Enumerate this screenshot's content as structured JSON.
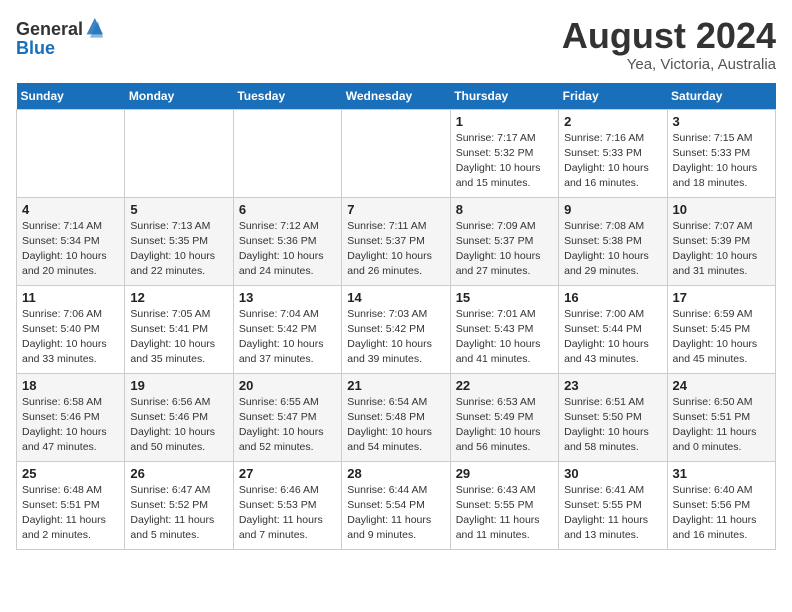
{
  "logo": {
    "general": "General",
    "blue": "Blue"
  },
  "header": {
    "month_year": "August 2024",
    "location": "Yea, Victoria, Australia"
  },
  "weekdays": [
    "Sunday",
    "Monday",
    "Tuesday",
    "Wednesday",
    "Thursday",
    "Friday",
    "Saturday"
  ],
  "weeks": [
    [
      {
        "day": "",
        "info": ""
      },
      {
        "day": "",
        "info": ""
      },
      {
        "day": "",
        "info": ""
      },
      {
        "day": "",
        "info": ""
      },
      {
        "day": "1",
        "info": "Sunrise: 7:17 AM\nSunset: 5:32 PM\nDaylight: 10 hours\nand 15 minutes."
      },
      {
        "day": "2",
        "info": "Sunrise: 7:16 AM\nSunset: 5:33 PM\nDaylight: 10 hours\nand 16 minutes."
      },
      {
        "day": "3",
        "info": "Sunrise: 7:15 AM\nSunset: 5:33 PM\nDaylight: 10 hours\nand 18 minutes."
      }
    ],
    [
      {
        "day": "4",
        "info": "Sunrise: 7:14 AM\nSunset: 5:34 PM\nDaylight: 10 hours\nand 20 minutes."
      },
      {
        "day": "5",
        "info": "Sunrise: 7:13 AM\nSunset: 5:35 PM\nDaylight: 10 hours\nand 22 minutes."
      },
      {
        "day": "6",
        "info": "Sunrise: 7:12 AM\nSunset: 5:36 PM\nDaylight: 10 hours\nand 24 minutes."
      },
      {
        "day": "7",
        "info": "Sunrise: 7:11 AM\nSunset: 5:37 PM\nDaylight: 10 hours\nand 26 minutes."
      },
      {
        "day": "8",
        "info": "Sunrise: 7:09 AM\nSunset: 5:37 PM\nDaylight: 10 hours\nand 27 minutes."
      },
      {
        "day": "9",
        "info": "Sunrise: 7:08 AM\nSunset: 5:38 PM\nDaylight: 10 hours\nand 29 minutes."
      },
      {
        "day": "10",
        "info": "Sunrise: 7:07 AM\nSunset: 5:39 PM\nDaylight: 10 hours\nand 31 minutes."
      }
    ],
    [
      {
        "day": "11",
        "info": "Sunrise: 7:06 AM\nSunset: 5:40 PM\nDaylight: 10 hours\nand 33 minutes."
      },
      {
        "day": "12",
        "info": "Sunrise: 7:05 AM\nSunset: 5:41 PM\nDaylight: 10 hours\nand 35 minutes."
      },
      {
        "day": "13",
        "info": "Sunrise: 7:04 AM\nSunset: 5:42 PM\nDaylight: 10 hours\nand 37 minutes."
      },
      {
        "day": "14",
        "info": "Sunrise: 7:03 AM\nSunset: 5:42 PM\nDaylight: 10 hours\nand 39 minutes."
      },
      {
        "day": "15",
        "info": "Sunrise: 7:01 AM\nSunset: 5:43 PM\nDaylight: 10 hours\nand 41 minutes."
      },
      {
        "day": "16",
        "info": "Sunrise: 7:00 AM\nSunset: 5:44 PM\nDaylight: 10 hours\nand 43 minutes."
      },
      {
        "day": "17",
        "info": "Sunrise: 6:59 AM\nSunset: 5:45 PM\nDaylight: 10 hours\nand 45 minutes."
      }
    ],
    [
      {
        "day": "18",
        "info": "Sunrise: 6:58 AM\nSunset: 5:46 PM\nDaylight: 10 hours\nand 47 minutes."
      },
      {
        "day": "19",
        "info": "Sunrise: 6:56 AM\nSunset: 5:46 PM\nDaylight: 10 hours\nand 50 minutes."
      },
      {
        "day": "20",
        "info": "Sunrise: 6:55 AM\nSunset: 5:47 PM\nDaylight: 10 hours\nand 52 minutes."
      },
      {
        "day": "21",
        "info": "Sunrise: 6:54 AM\nSunset: 5:48 PM\nDaylight: 10 hours\nand 54 minutes."
      },
      {
        "day": "22",
        "info": "Sunrise: 6:53 AM\nSunset: 5:49 PM\nDaylight: 10 hours\nand 56 minutes."
      },
      {
        "day": "23",
        "info": "Sunrise: 6:51 AM\nSunset: 5:50 PM\nDaylight: 10 hours\nand 58 minutes."
      },
      {
        "day": "24",
        "info": "Sunrise: 6:50 AM\nSunset: 5:51 PM\nDaylight: 11 hours\nand 0 minutes."
      }
    ],
    [
      {
        "day": "25",
        "info": "Sunrise: 6:48 AM\nSunset: 5:51 PM\nDaylight: 11 hours\nand 2 minutes."
      },
      {
        "day": "26",
        "info": "Sunrise: 6:47 AM\nSunset: 5:52 PM\nDaylight: 11 hours\nand 5 minutes."
      },
      {
        "day": "27",
        "info": "Sunrise: 6:46 AM\nSunset: 5:53 PM\nDaylight: 11 hours\nand 7 minutes."
      },
      {
        "day": "28",
        "info": "Sunrise: 6:44 AM\nSunset: 5:54 PM\nDaylight: 11 hours\nand 9 minutes."
      },
      {
        "day": "29",
        "info": "Sunrise: 6:43 AM\nSunset: 5:55 PM\nDaylight: 11 hours\nand 11 minutes."
      },
      {
        "day": "30",
        "info": "Sunrise: 6:41 AM\nSunset: 5:55 PM\nDaylight: 11 hours\nand 13 minutes."
      },
      {
        "day": "31",
        "info": "Sunrise: 6:40 AM\nSunset: 5:56 PM\nDaylight: 11 hours\nand 16 minutes."
      }
    ]
  ]
}
